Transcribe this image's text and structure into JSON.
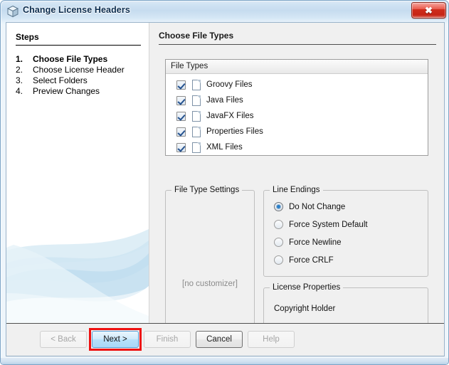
{
  "window": {
    "title": "Change License Headers",
    "app_icon": "cube-icon",
    "close_label": "✖"
  },
  "steps_pane": {
    "title": "Steps",
    "items": [
      {
        "num": "1.",
        "label": "Choose File Types",
        "active": true
      },
      {
        "num": "2.",
        "label": "Choose License Header",
        "active": false
      },
      {
        "num": "3.",
        "label": "Select Folders",
        "active": false
      },
      {
        "num": "4.",
        "label": "Preview Changes",
        "active": false
      }
    ]
  },
  "content": {
    "title": "Choose File Types",
    "file_types_panel": {
      "header": "File Types",
      "rows": [
        {
          "label": "Groovy Files",
          "checked": true,
          "icon": "document-icon"
        },
        {
          "label": "Java Files",
          "checked": true,
          "icon": "document-icon"
        },
        {
          "label": "JavaFX Files",
          "checked": true,
          "icon": "document-icon"
        },
        {
          "label": "Properties Files",
          "checked": true,
          "icon": "document-icon"
        },
        {
          "label": "XML Files",
          "checked": true,
          "icon": "document-icon"
        }
      ]
    },
    "file_type_settings": {
      "title": "File Type Settings",
      "empty_text": "[no customizer]"
    },
    "line_endings": {
      "title": "Line Endings",
      "options": [
        {
          "label": "Do Not Change",
          "selected": true
        },
        {
          "label": "Force System Default",
          "selected": false
        },
        {
          "label": "Force Newline",
          "selected": false
        },
        {
          "label": "Force CRLF",
          "selected": false
        }
      ]
    },
    "license_properties": {
      "title": "License Properties",
      "copyright_holder_label": "Copyright Holder"
    }
  },
  "buttons": {
    "back": "< Back",
    "next": "Next >",
    "finish": "Finish",
    "cancel": "Cancel",
    "help": "Help"
  },
  "colors": {
    "annotation": "#ee1111",
    "default_button": "#b6e0fa",
    "titlebar": "#cfe2f3",
    "close_button": "#cf2d1c"
  }
}
